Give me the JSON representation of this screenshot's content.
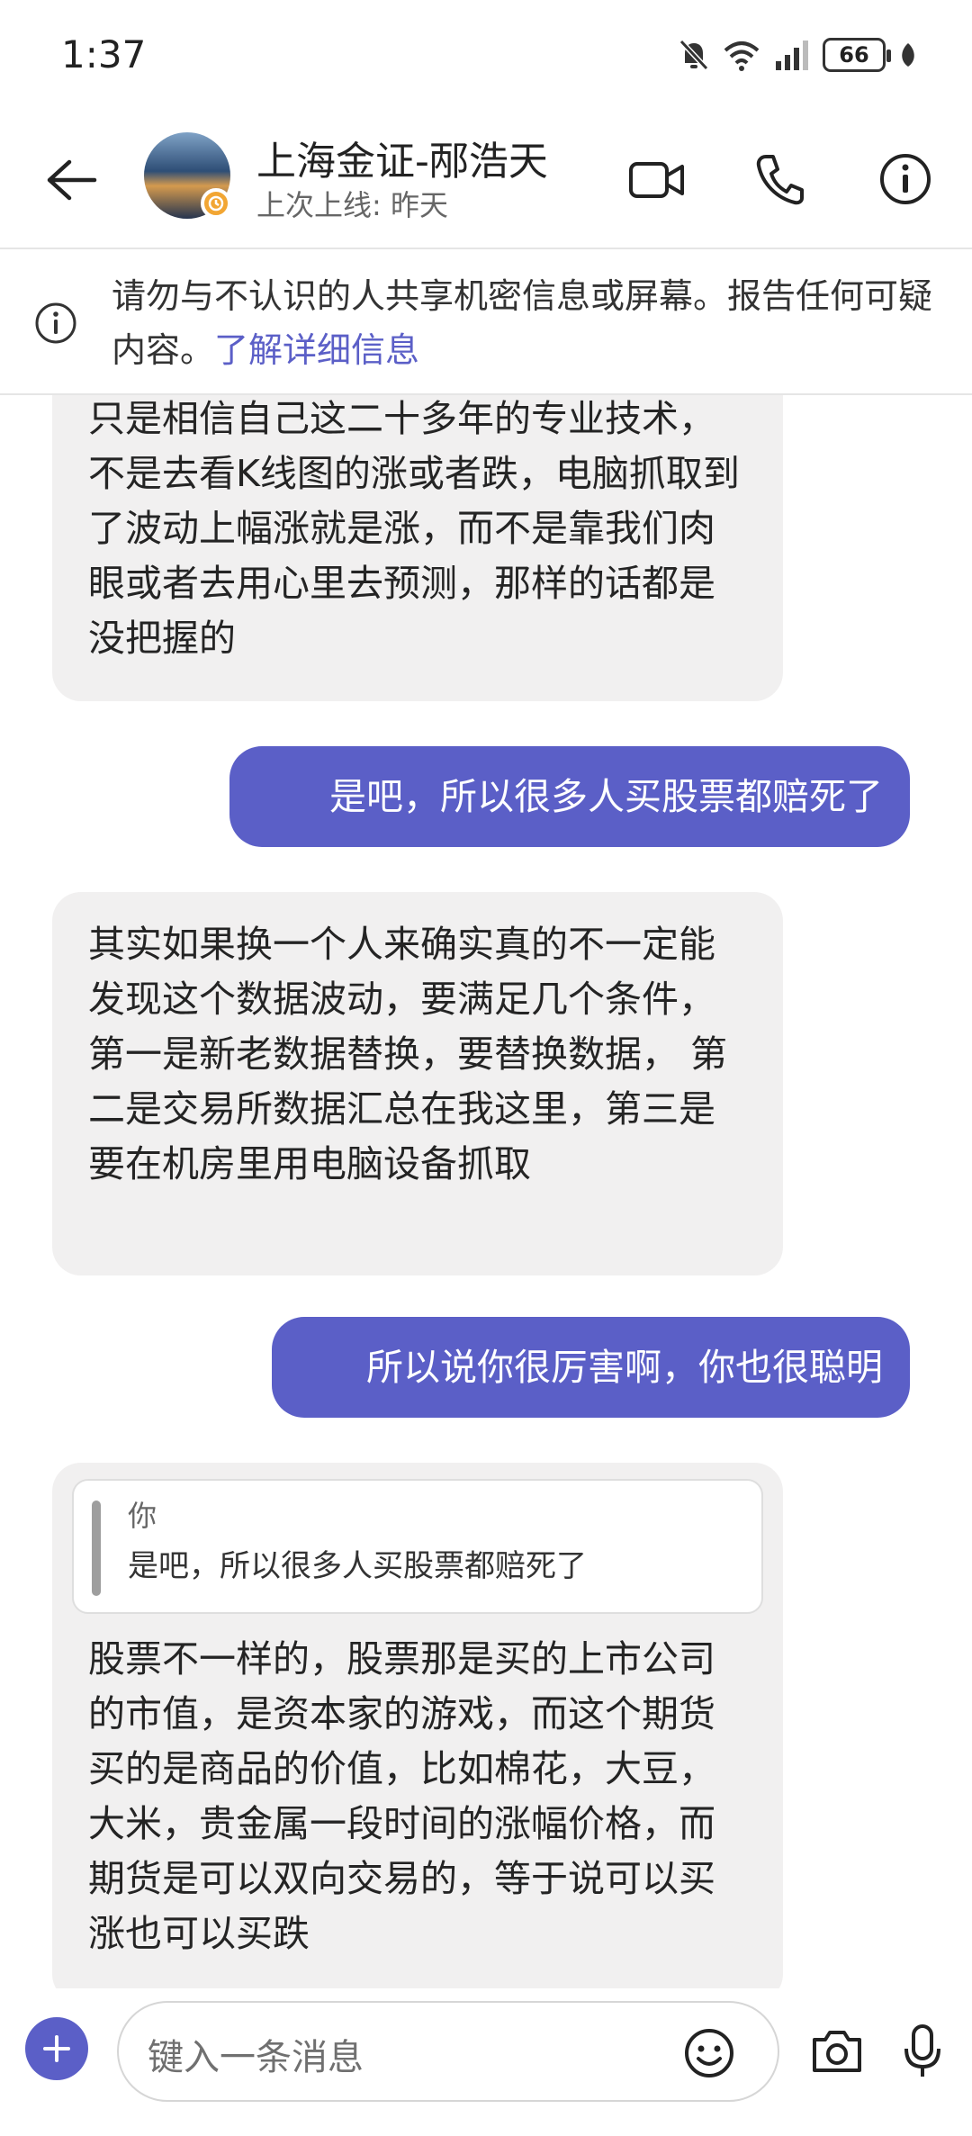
{
  "status_bar": {
    "time": "1:37",
    "battery": "66"
  },
  "header": {
    "contact_name": "上海金证-邴浩天",
    "last_seen": "上次上线: 昨天"
  },
  "banner": {
    "text": "请勿与不认识的人共享机密信息或屏幕。报告任何可疑内容。",
    "link": "了解详细信息"
  },
  "messages": [
    {
      "direction": "incoming",
      "text": "只是相信自己这二十多年的专业技术，不是去看K线图的涨或者跌，电脑抓取到了波动上幅涨就是涨，而不是靠我们肉眼或者去用心里去预测，那样的话都是没把握的"
    },
    {
      "direction": "outgoing",
      "text": "是吧，所以很多人买股票都赔死了"
    },
    {
      "direction": "incoming",
      "text": "其实如果换一个人来确实真的不一定能发现这个数据波动，要满足几个条件，第一是新老数据替换，要替换数据， 第二是交易所数据汇总在我这里，第三是要在机房里用电脑设备抓取"
    },
    {
      "direction": "outgoing",
      "text": "所以说你很厉害啊，你也很聪明"
    },
    {
      "direction": "incoming",
      "quote": {
        "author": "你",
        "text": "是吧，所以很多人买股票都赔死了"
      },
      "text": "股票不一样的，股票那是买的上市公司的市值，是资本家的游戏，而这个期货买的是商品的价值，比如棉花，大豆，大米，贵金属一段时间的涨幅价格，而期货是可以双向交易的，等于说可以买涨也可以买跌"
    }
  ],
  "composer": {
    "placeholder": "键入一条消息"
  },
  "colors": {
    "accent": "#5b5fc7",
    "incoming_bubble": "#f1f0f0",
    "badge": "#f2a633"
  }
}
